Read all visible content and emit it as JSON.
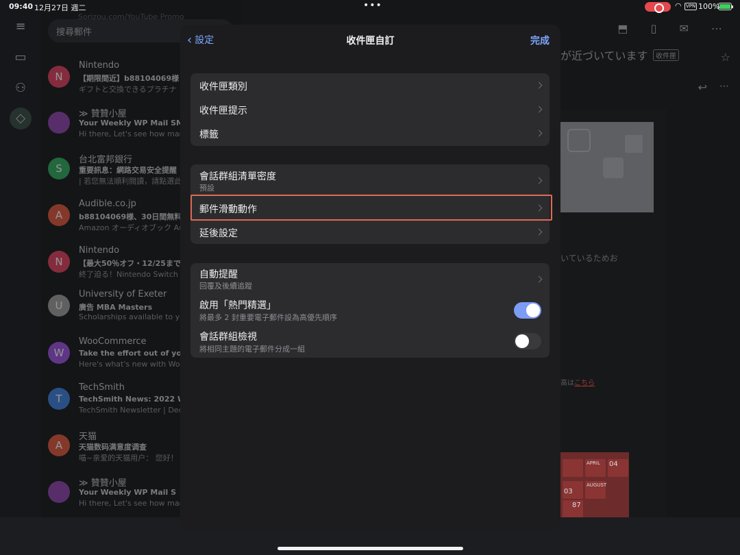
{
  "status_bar": {
    "time": "09:40",
    "date": "12月27日 週二",
    "vpn": "VPN",
    "battery": "100%"
  },
  "background": {
    "search_placeholder": "搜尋郵件",
    "search_promo": "Sorizou.com/YouTube Promo",
    "emails": [
      {
        "initial": "N",
        "color": "#e0405f",
        "sender": "Nintendo",
        "subject": "【期限間近】b88104069様 ア",
        "snippet": "ギフトと交換できるプラチナ"
      },
      {
        "initial": "",
        "color": "#8e44ad",
        "sender": "≫ 贊贊小屋",
        "subject": "Your Weekly WP Mail SMTP",
        "snippet": "Hi there, Let's see how many"
      },
      {
        "initial": "S",
        "color": "#2eaa5c",
        "sender": "台北富邦銀行",
        "subject": "重要訊息：網路交易安全提醒",
        "snippet": "| 若您無法順利閱讀，請點選此"
      },
      {
        "initial": "A",
        "color": "#e0553a",
        "sender": "Audible.co.jp",
        "subject": "b88104069様、30日間無料",
        "snippet": "Amazon オーディオブック Au"
      },
      {
        "initial": "N",
        "color": "#e0405f",
        "sender": "Nintendo",
        "subject": "【最大50％オフ・12/25まで",
        "snippet": "終了迫る！Nintendo Switch イ"
      },
      {
        "initial": "U",
        "color": "#9e9e9e",
        "sender": "University of Exeter",
        "subject": "廣告  MBA Masters",
        "snippet": "Scholarships available to you"
      },
      {
        "initial": "W",
        "color": "#9b51e0",
        "sender": "WooCommerce",
        "subject": "Take the effort out of your s",
        "snippet": "Here's what's new with WooC"
      },
      {
        "initial": "T",
        "color": "#3d7fe0",
        "sender": "TechSmith",
        "subject": "TechSmith News: 2022 Wra",
        "snippet": "TechSmith Newsletter | Dece"
      },
      {
        "initial": "A",
        "color": "#e0553a",
        "sender": "天猫",
        "subject": "天猫数码满意度调查",
        "snippet": "喵~亲爱的天猫用户： 您好！"
      },
      {
        "initial": "",
        "color": "#8e44ad",
        "sender": "≫ 贊贊小屋",
        "subject": "Your Weekly WP Mail S",
        "snippet": "Hi there, Let's see how many"
      }
    ],
    "reader_title": "が近づいています",
    "reader_label": "收件匣",
    "reader_text1": "いているためお",
    "reader_text2": "高は",
    "reader_link": "こちら",
    "calendar_text": [
      "04",
      "APRIL",
      "03",
      "AUGUST",
      "87"
    ]
  },
  "modal": {
    "back_label": "設定",
    "title": "收件匣自訂",
    "done_label": "完成",
    "group1": [
      {
        "label": "收件匣類別"
      },
      {
        "label": "收件匣提示"
      },
      {
        "label": "標籤"
      }
    ],
    "group2": [
      {
        "label": "會話群組清單密度",
        "sub": "預設"
      },
      {
        "label": "郵件滑動動作"
      },
      {
        "label": "延後設定"
      }
    ],
    "group3": [
      {
        "label": "自動提醒",
        "sub": "回覆及後續追蹤"
      },
      {
        "label": "啟用「熱門精選」",
        "sub": "將最多 2 封重要電子郵件設為高優先順序",
        "toggle": true
      },
      {
        "label": "會話群組檢視",
        "sub": "將相同主題的電子郵件分成一組",
        "toggle": false
      }
    ]
  }
}
